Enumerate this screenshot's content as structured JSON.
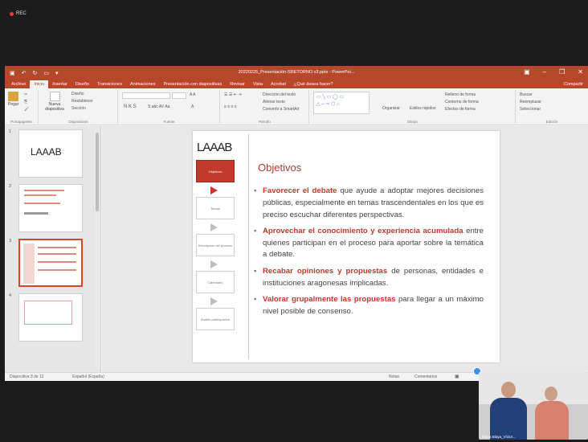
{
  "recording": {
    "label": "REC"
  },
  "window": {
    "title": "20220225_Presentación-SRETORNO v3.pptx - PowerPoi...",
    "share": "Compartir"
  },
  "tabs": [
    "Archivo",
    "Inicio",
    "Insertar",
    "Diseño",
    "Transiciones",
    "Animaciones",
    "Presentación con diapositivas",
    "Revisar",
    "Vista",
    "Acrobat",
    "¿Qué desea hacer?"
  ],
  "ribbon": {
    "paste": "Pegar",
    "new_slide": "Nueva diapositiva",
    "design": "Diseño",
    "reset": "Restablecer",
    "section": "Sección",
    "font_format": "N K S",
    "text_direction": "Dirección del texto",
    "align_text": "Alinear texto",
    "smartart": "Convertir a SmartArt",
    "arrange": "Organizar",
    "quick_styles": "Estilos rápidos",
    "shape_fill": "Relleno de forma",
    "shape_outline": "Contorno de forma",
    "shape_effects": "Efectos de forma",
    "find": "Buscar",
    "replace": "Reemplazar",
    "select": "Seleccionar",
    "groups": [
      "Portapapeles",
      "Diapositivas",
      "Fuente",
      "Párrafo",
      "Dibujo",
      "Edición"
    ]
  },
  "thumbnails": [
    "1",
    "2",
    "3",
    "4"
  ],
  "slide": {
    "logo": "LAAAB",
    "title": "Objetivos",
    "flow": [
      "Objetivos",
      "Temas",
      "Descripción del proceso",
      "Calendario",
      "Ámbito participación"
    ],
    "bullets": [
      {
        "strong": "Favorecer el debate",
        "text": " que ayude a adoptar mejores decisiones públicas, especialmente en temas trascendentales en los que es preciso escuchar diferentes perspectivas."
      },
      {
        "strong": "Aprovechar el conocimiento y experiencia acumulada",
        "text": " entre quienes participan en el proceso para aportar sobre la temática a debate."
      },
      {
        "strong": "Recabar opiniones y propuestas",
        "text": " de personas, entidades e instituciones aragonesas implicadas."
      },
      {
        "strong": "Valorar grupalmente las propuestas",
        "text": " para llegar a un máximo nivel posible de consenso."
      }
    ]
  },
  "status": {
    "slide_info": "Diapositiva 3 de 12",
    "language": "Español (España)",
    "notes": "Notas",
    "comments": "Comentarios"
  },
  "webcam": {
    "caption": "María Blaya_Víctor..."
  },
  "colors": {
    "accent": "#b7472a",
    "highlight": "#c0392b"
  }
}
